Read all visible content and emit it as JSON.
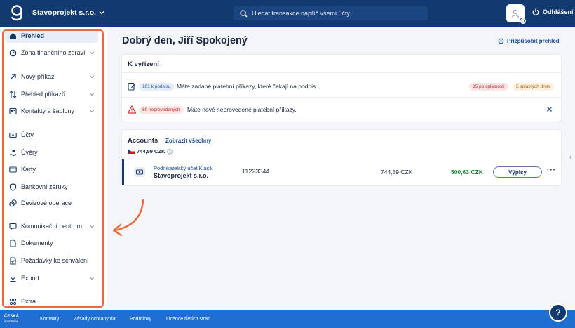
{
  "header": {
    "company": "Stavoprojekt s.r.o.",
    "search_placeholder": "Hledat transakce napříč všemi účty",
    "logout": "Odhlášení"
  },
  "sidebar": {
    "items": [
      {
        "label": "Přehled",
        "icon": "home-icon",
        "active": true
      },
      {
        "label": "Zóna finančního zdraví",
        "icon": "gauge-icon"
      },
      {
        "label": "Nový příkaz",
        "icon": "arrow-up-right-icon"
      },
      {
        "label": "Přehled příkazů",
        "icon": "transfer-arrows-icon"
      },
      {
        "label": "Kontakty a šablony",
        "icon": "contact-card-icon"
      },
      {
        "label": "Účty",
        "icon": "banknote-icon"
      },
      {
        "label": "Úvěry",
        "icon": "hand-coin-icon"
      },
      {
        "label": "Karty",
        "icon": "card-icon"
      },
      {
        "label": "Bankovní záruky",
        "icon": "shield-icon"
      },
      {
        "label": "Devizové operace",
        "icon": "currency-exchange-icon"
      },
      {
        "label": "Komunikační centrum",
        "icon": "chat-icon"
      },
      {
        "label": "Dokumenty",
        "icon": "document-icon"
      },
      {
        "label": "Požadavky ke schválení",
        "icon": "approval-doc-icon"
      },
      {
        "label": "Export",
        "icon": "download-icon"
      },
      {
        "label": "Extra",
        "icon": "grid-dots-icon"
      }
    ]
  },
  "main": {
    "greeting": "Dobrý den, Jiří Spokojený",
    "customize": "Přizpůsobit přehled",
    "todo": {
      "title": "K vyřízení",
      "rows": [
        {
          "badge": "101 k podpisu",
          "text": "Máte zadané platební příkazy, které čekají na podpis.",
          "pill_due": "95 po splatnosti",
          "pill_due_soon": "5 splatných dnes"
        },
        {
          "badge": "69 neprovedených",
          "text": "Máte nové neprovedené platební příkazy."
        }
      ]
    },
    "accounts": {
      "title": "Accounts",
      "show_all": "Zobrazit všechny",
      "total": "744,59 CZK",
      "rows": [
        {
          "type": "Podnikatelský účet Klasik",
          "name": "Stavoprojekt s.r.o.",
          "number": "11223344",
          "balance": "744,59 CZK",
          "available": "500,63 CZK",
          "button": "Výpisy",
          "more": "···"
        }
      ]
    }
  },
  "footer": {
    "logo_line1": "ČESKÁ",
    "logo_line2": "spořitelna",
    "links": [
      "Kontakty",
      "Zásady ochrany dat",
      "Podmínky",
      "Licence třetích stran"
    ],
    "help": "?"
  },
  "colors": {
    "header_bg": "#133a70",
    "footer_bg": "#1f6fd0",
    "accent_link": "#1a4ea3",
    "annotation": "#ec6a3a",
    "positive": "#1f8a3b"
  }
}
